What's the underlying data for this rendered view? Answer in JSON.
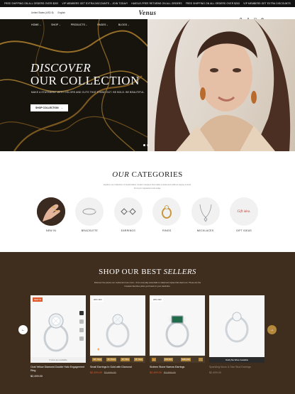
{
  "ticker": {
    "items": [
      "FREE SHIPPING ON ALL ORDERS OVER $200",
      "VIP MEMBERS GET EXTRA DISCOUNTS – JOIN TODAY!",
      "HASSLE-FREE RETURNS ON ALL ORDERS",
      "FREE SHIPPING ON ALL ORDERS OVER $200",
      "VIP MEMBERS GET EXTRA DISCOUNTS"
    ]
  },
  "header": {
    "currency": "United States (USD $)",
    "language": "English",
    "logo": "Venus"
  },
  "nav": {
    "items": [
      "HOME",
      "SHOP",
      "PRODUCTS",
      "PAGES",
      "BLOGS"
    ]
  },
  "hero": {
    "title_line1": "DISCOVER",
    "title_line2": "OUR COLLECTION",
    "subtitle": "MAKE A STATEMENT WITH COLORS AND CUTS THAT STAND OUT. BE BOLD. BE BEAUTIFUL.",
    "button_label": "SHOP COLLECTION",
    "slide_count": 2,
    "active_slide": 1
  },
  "categories": {
    "title_em": "OUR",
    "title_rest": " CATEGORIES",
    "subtitle_line1": "Explore our collection of handcrafted, modern designs that make a statement without saying a word.",
    "subtitle_line2": "Find your signature look today.",
    "items": [
      {
        "label": "NEW IN"
      },
      {
        "label": "BRACELETE"
      },
      {
        "label": "EARRINGS"
      },
      {
        "label": "RINGS"
      },
      {
        "label": "NECKLACES"
      },
      {
        "label": "GIFT IDEAS",
        "image_text": "Gift idea."
      }
    ]
  },
  "best_sellers": {
    "title_rest": "SHOP OUR BEST ",
    "title_em": "SELLERS",
    "subtitle_line1": "Discover the pieces our customers love most – from everyday essentials to statement styles that stand out. These are the",
    "subtitle_line2": "timeless favorites picks you'll want in your wardrobe.",
    "products": [
      {
        "name": "Oval Yellow Diamond Double Halo Engagement Ring",
        "price": "$2,499.00",
        "badge": "NEW IN",
        "strip": "5 sizes are available",
        "dimmed": false
      },
      {
        "name": "Small Earrings In Gold with Diamond",
        "sale_price": "$2,499.00",
        "old_price": "$2,899.00",
        "badge": "20% OFF",
        "countdown": [
          "114 : Days",
          "13 : Hours",
          "28 : Mins",
          "25 : Secs"
        ],
        "dimmed": false
      },
      {
        "name": "Sixteen Stone Narrow Earrings",
        "sale_price": "$2,499.00",
        "old_price": "$2,899.00",
        "badge": "20% OFF",
        "extra_badge": "Selling fast",
        "dimmed": false
      },
      {
        "name": "Sparkling Moon & Star Stud Earrings",
        "price": "$2,499.00",
        "strip": "Notify Me When Available",
        "dimmed": true
      }
    ]
  },
  "colors": {
    "accent": "#b5893b",
    "sale": "#e05a2c",
    "brown": "#3f2e1e"
  }
}
